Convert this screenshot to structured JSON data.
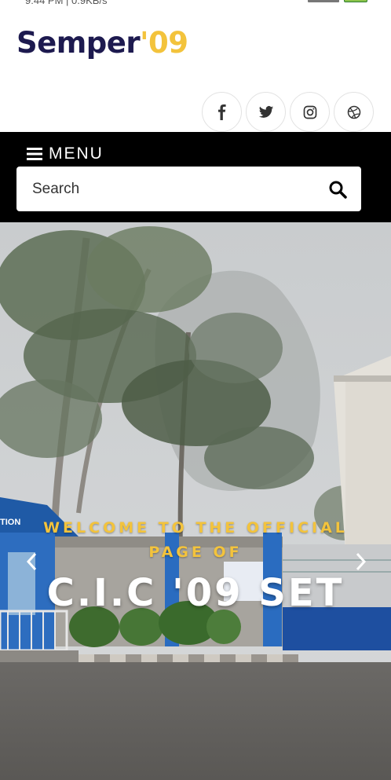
{
  "status_bar": {
    "left_text": "9:44 PM | 0.9KB/s"
  },
  "brand": {
    "name": "Semper",
    "suffix": "'09"
  },
  "social": [
    {
      "name": "facebook-icon",
      "glyph": "f"
    },
    {
      "name": "twitter-icon"
    },
    {
      "name": "instagram-icon"
    },
    {
      "name": "dribbble-icon"
    }
  ],
  "nav": {
    "menu_label": "MENU"
  },
  "search": {
    "placeholder": "Search",
    "value": ""
  },
  "hero": {
    "welcome_line1": "WELCOME TO THE OFFICIAL",
    "welcome_line2": "PAGE OF",
    "title": "C.I.C '09 SET",
    "sign_text": "TION"
  },
  "colors": {
    "brand_dark": "#1d1a4f",
    "accent": "#f3c33c",
    "nav_bg": "#000000"
  }
}
